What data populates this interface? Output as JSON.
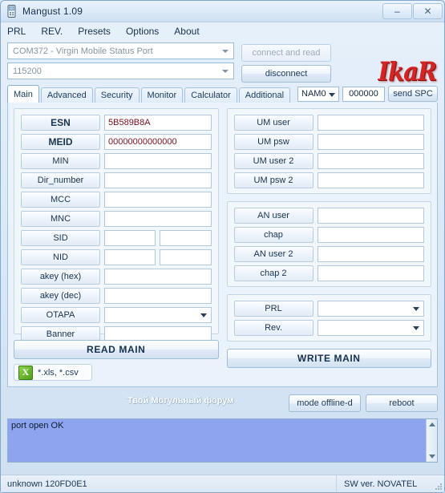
{
  "window": {
    "title": "Mangust 1.09",
    "icon": "phone-icon",
    "minimize_label": "–",
    "close_label": "✕"
  },
  "menu": [
    {
      "label": "PRL"
    },
    {
      "label": "REV."
    },
    {
      "label": "Presets"
    },
    {
      "label": "Options"
    },
    {
      "label": "About"
    }
  ],
  "top": {
    "port_value": "COM372 - Virgin Mobile Status Port",
    "baud_value": "115200",
    "connect_label": "connect and read",
    "disconnect_label": "disconnect",
    "logo": "IkaR"
  },
  "tabs": [
    {
      "label": "Main",
      "active": true
    },
    {
      "label": "Advanced",
      "active": false
    },
    {
      "label": "Security",
      "active": false
    },
    {
      "label": "Monitor",
      "active": false
    },
    {
      "label": "Calculator",
      "active": false
    },
    {
      "label": "Additional",
      "active": false
    }
  ],
  "tab_tools": {
    "nam_value": "NAM0",
    "spc_value": "000000",
    "send_spc_label": "send SPC"
  },
  "left_panel": {
    "rows": [
      {
        "label": "ESN",
        "value": "5B589B8A",
        "type": "text",
        "strong": true
      },
      {
        "label": "MEID",
        "value": "00000000000000",
        "type": "text",
        "strong": true
      },
      {
        "label": "MIN",
        "value": "",
        "type": "text"
      },
      {
        "label": "Dir_number",
        "value": "",
        "type": "text"
      },
      {
        "label": "MCC",
        "value": "",
        "type": "text"
      },
      {
        "label": "MNC",
        "value": "",
        "type": "text"
      },
      {
        "label": "SID",
        "value": "",
        "value2": "",
        "type": "double"
      },
      {
        "label": "NID",
        "value": "",
        "value2": "",
        "type": "double"
      },
      {
        "label": "akey (hex)",
        "value": "",
        "type": "text"
      },
      {
        "label": "akey (dec)",
        "value": "",
        "type": "text"
      },
      {
        "label": "OTAPA",
        "value": "",
        "type": "combo"
      },
      {
        "label": "Banner",
        "value": "",
        "type": "text"
      }
    ],
    "read_button": "READ MAIN",
    "export_button": "*.xls, *.csv",
    "export_icon": "excel-icon"
  },
  "right_panel": {
    "group_um": [
      {
        "label": "UM user",
        "value": ""
      },
      {
        "label": "UM psw",
        "value": ""
      },
      {
        "label": "UM user 2",
        "value": ""
      },
      {
        "label": "UM psw 2",
        "value": ""
      }
    ],
    "group_an": [
      {
        "label": "AN user",
        "value": ""
      },
      {
        "label": "chap",
        "value": ""
      },
      {
        "label": "AN user 2",
        "value": ""
      },
      {
        "label": "chap 2",
        "value": ""
      }
    ],
    "group_prl": [
      {
        "label": "PRL",
        "value": ""
      },
      {
        "label": "Rev.",
        "value": ""
      }
    ],
    "write_button": "WRITE MAIN"
  },
  "footer": {
    "forum_text": "Твой Могульный форум",
    "mode_button": "mode offline-d",
    "reboot_button": "reboot"
  },
  "log": {
    "lines": "port open OK"
  },
  "statusbar": {
    "left": "unknown 120FD0E1",
    "right": "SW ver. NOVATEL"
  },
  "colors": {
    "accent": "#d42525",
    "field_text": "#7a1020",
    "log_bg": "#8ea4ee",
    "window_bg": "#dce9f7"
  }
}
